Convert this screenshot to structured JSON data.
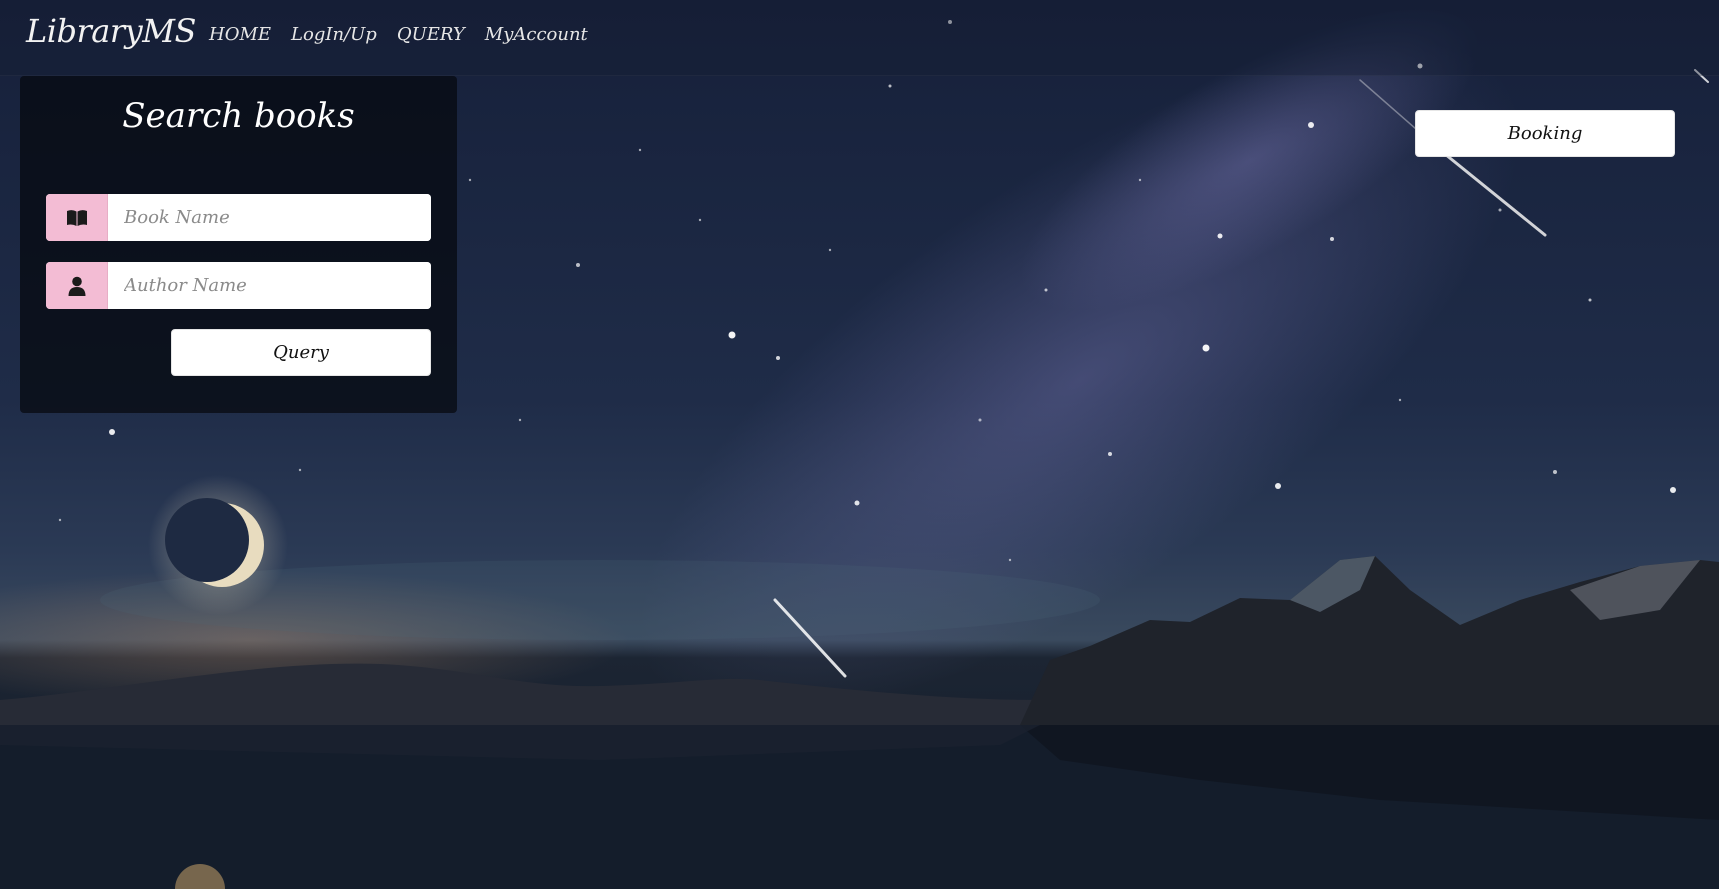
{
  "navbar": {
    "brand": "LibraryMS",
    "links": [
      {
        "label": "HOME"
      },
      {
        "label": "LogIn/Up"
      },
      {
        "label": "QUERY"
      },
      {
        "label": "MyAccount"
      }
    ]
  },
  "search_panel": {
    "title": "Search books",
    "book_name": {
      "value": "",
      "placeholder": "Book Name",
      "icon": "book-icon"
    },
    "author_name": {
      "value": "",
      "placeholder": "Author Name",
      "icon": "user-icon"
    },
    "query_label": "Query"
  },
  "booking_label": "Booking",
  "colors": {
    "addon_pink": "#f3bcd4",
    "panel_bg": "#06080e",
    "sky": "#1a2336"
  }
}
